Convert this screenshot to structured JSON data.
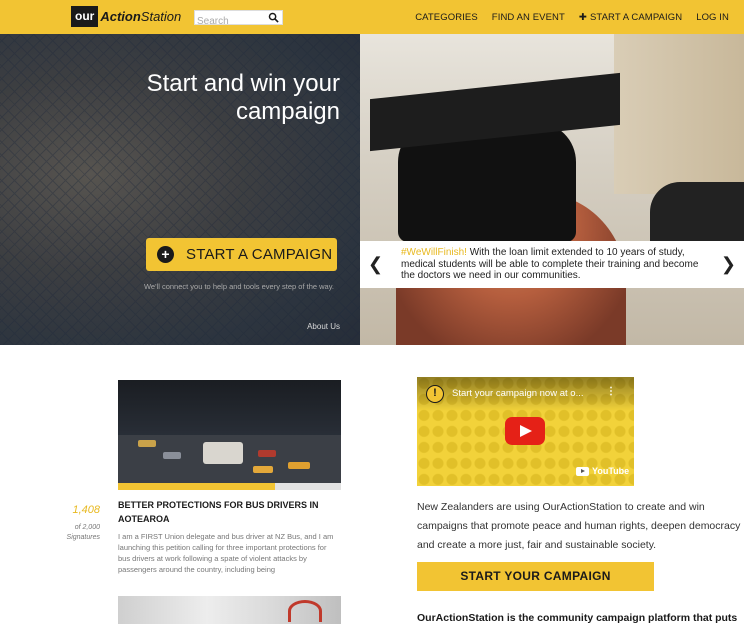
{
  "nav": {
    "logo_our": "our",
    "logo_action": "Action",
    "logo_station": "Station",
    "search_placeholder": "Search",
    "links": [
      "CATEGORIES",
      "FIND AN EVENT",
      "START A CAMPAIGN",
      "LOG IN"
    ],
    "plus_glyph": "✚"
  },
  "hero": {
    "title": "Start and win your campaign",
    "cta_label": "START A CAMPAIGN",
    "sub": "We'll connect you to help and tools every step of the way.",
    "about": "About Us",
    "caption_tag": "#WeWillFinish!",
    "caption_text": " With the loan limit extended to 10 years of study, medical students will be able to complete their training and become the doctors we need in our communities.",
    "prev_arrow": "❮",
    "next_arrow": "❯"
  },
  "petition": {
    "signatures": "1,408",
    "of_signatures": "of 2,000 Signatures",
    "progress": 0.704,
    "title": "BETTER PROTECTIONS FOR BUS DRIVERS IN AOTEAROA",
    "body": "I am a FIRST Union delegate and bus driver at NZ Bus, and I am launching this petition calling for three important protections for bus drivers at work following a spate of violent attacks by passengers around the country, including being"
  },
  "video": {
    "channel_glyph": "!",
    "title": "Start your campaign now at o...",
    "menu_glyph": "⋮",
    "brand": "YouTube"
  },
  "intro": "New Zealanders are using OurActionStation to create and win campaigns that promote peace and human rights, deepen democracy and create a more just, fair and sustainable society.",
  "start_button": "START YOUR CAMPAIGN",
  "tagline": "OurActionStation is the community campaign platform that puts",
  "colors": {
    "brand_yellow": "#f2c433",
    "accent_text": "#e8b920",
    "dark": "#1a1a1a"
  }
}
